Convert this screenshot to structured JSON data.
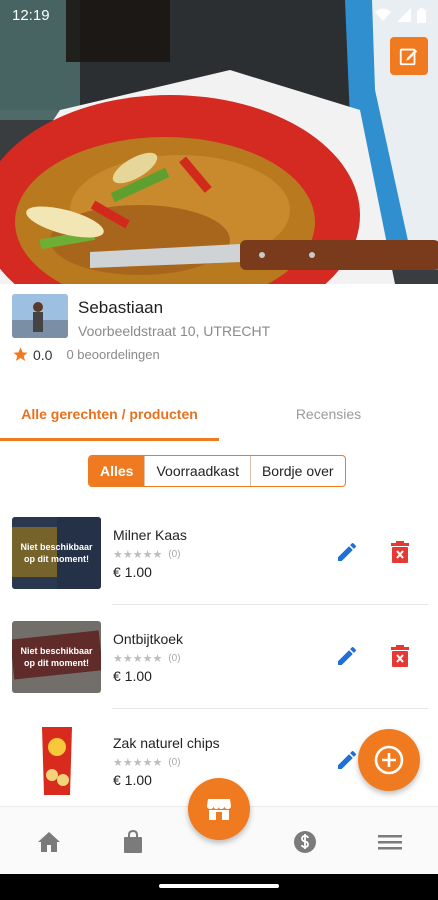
{
  "status_bar": {
    "time": "12:19"
  },
  "store": {
    "name": "Sebastiaan",
    "address": "Voorbeeldstraat 10, UTRECHT",
    "rating": "0.0",
    "reviews": "0 beoordelingen"
  },
  "tabs": [
    {
      "label": "Alle gerechten / producten",
      "active": true
    },
    {
      "label": "Recensies",
      "active": false
    }
  ],
  "filters": [
    {
      "label": "Alles",
      "active": true
    },
    {
      "label": "Voorraadkast",
      "active": false
    },
    {
      "label": "Bordje over",
      "active": false
    }
  ],
  "products": [
    {
      "name": "Milner Kaas",
      "stars": "★★★★★",
      "count": "(0)",
      "price": "€ 1.00",
      "unavailable": "Niet beschikbaar op dit moment!"
    },
    {
      "name": "Ontbijtkoek",
      "stars": "★★★★★",
      "count": "(0)",
      "price": "€ 1.00",
      "unavailable": "Niet beschikbaar op dit moment!"
    },
    {
      "name": "Zak naturel chips",
      "stars": "★★★★★",
      "count": "(0)",
      "price": "€ 1.00"
    }
  ],
  "colors": {
    "accent": "#f07a1f",
    "delete": "#e53935",
    "edit": "#1e6fd9"
  },
  "icons": [
    "edit-icon",
    "star-icon",
    "pencil-icon",
    "delete-icon",
    "add-icon",
    "store-icon",
    "home-icon",
    "bag-icon",
    "dollar-icon",
    "menu-icon"
  ]
}
